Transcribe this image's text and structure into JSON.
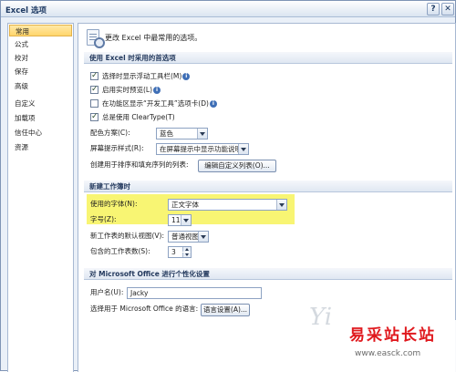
{
  "window": {
    "title": "Excel 选项",
    "help_glyph": "?",
    "close_glyph": "✕"
  },
  "sidebar": {
    "items": [
      {
        "label": "常用",
        "active": true
      },
      {
        "label": "公式"
      },
      {
        "label": "校对"
      },
      {
        "label": "保存"
      },
      {
        "label": "高级"
      },
      {
        "label": "自定义"
      },
      {
        "label": "加载项"
      },
      {
        "label": "信任中心"
      },
      {
        "label": "资源"
      }
    ]
  },
  "header": {
    "text": "更改 Excel 中最常用的选项。",
    "icon": "options-gear-doc-icon"
  },
  "sections": {
    "top": {
      "title": "使用 Excel 时采用的首选项",
      "options": [
        {
          "label": "选择时显示浮动工具栏(M)",
          "checked": true,
          "info": true
        },
        {
          "label": "启用实时预览(L)",
          "checked": true,
          "info": true
        },
        {
          "label": "在功能区显示“开发工具”选项卡(D)",
          "checked": false,
          "info": true
        },
        {
          "label": "总是使用 ClearType(T)",
          "checked": true,
          "info": false
        }
      ],
      "color_scheme_label": "配色方案(C):",
      "color_scheme_value": "蓝色",
      "screentip_label": "屏幕提示样式(R):",
      "screentip_value": "在屏幕提示中显示功能说明",
      "custom_list_label": "创建用于排序和填充序列的列表:",
      "custom_list_button": "编辑自定义列表(O)..."
    },
    "new_workbook": {
      "title": "新建工作簿时",
      "font_label": "使用的字体(N):",
      "font_value": "正文字体",
      "size_label": "字号(Z):",
      "size_value": "11",
      "view_label": "新工作表的默认视图(V):",
      "view_value": "普通视图",
      "sheets_label": "包含的工作表数(S):",
      "sheets_value": "3"
    },
    "personalize": {
      "title": "对 Microsoft Office 进行个性化设置",
      "username_label": "用户名(U):",
      "username_value": "Jacky",
      "language_label": "选择用于 Microsoft Office 的语言:",
      "language_button": "语言设置(A)..."
    }
  },
  "highlight_color": "#f7f35a",
  "watermark": {
    "letter": "Yi",
    "site_name": "易采站长站",
    "site_url": "www.easck.com"
  }
}
